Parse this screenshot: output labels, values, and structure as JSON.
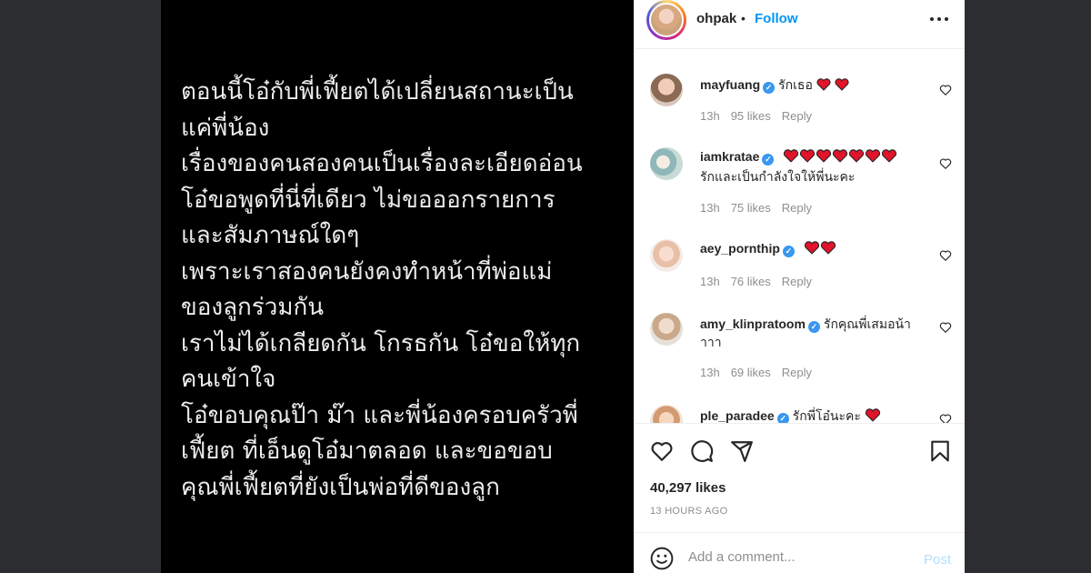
{
  "post": {
    "caption_lines": [
      "ตอนนี้โอ๋กับพี่เฟี้ยตได้เปลี่ยนสถานะเป็น",
      "แค่พี่น้อง",
      "เรื่องของคนสองคนเป็นเรื่องละเอียดอ่อน",
      "โอ๋ขอพูดที่นี่ที่เดียว ไม่ขอออกรายการ",
      "และสัมภาษณ์ใดๆ",
      "เพราะเราสองคนยังคงทำหน้าที่พ่อแม่",
      "ของลูกร่วมกัน",
      "เราไม่ได้เกลียดกัน โกรธกัน โอ๋ขอให้ทุก",
      "คนเข้าใจ",
      "โอ๋ขอบคุณป๊า ม๊า และพี่น้องครอบครัวพี่",
      "เฟี้ยต ที่เอ็นดูโอ๋มาตลอด และขอขอบ",
      "คุณพี่เฟี้ยตที่ยังเป็นพ่อที่ดีของลูก"
    ]
  },
  "header": {
    "username": "ohpak",
    "separator": "•",
    "follow_label": "Follow",
    "more_icon": "more-horizontal-icon"
  },
  "comments": [
    {
      "username": "mayfuang",
      "verified": true,
      "text": "รักเธอ",
      "hearts": 2,
      "text2": "",
      "time": "13h",
      "likes": "95 likes",
      "reply": "Reply"
    },
    {
      "username": "iamkratae",
      "verified": true,
      "text": "",
      "hearts": 7,
      "text2": "รักและเป็นกำลังใจให้พี่นะคะ",
      "time": "13h",
      "likes": "75 likes",
      "reply": "Reply"
    },
    {
      "username": "aey_pornthip",
      "verified": true,
      "text": "",
      "hearts": 2,
      "text2": "",
      "time": "13h",
      "likes": "76 likes",
      "reply": "Reply"
    },
    {
      "username": "amy_klinpratoom",
      "verified": true,
      "text": "รักคุณพี่เสมอน้า",
      "hearts": 0,
      "text2": "าาา",
      "time": "13h",
      "likes": "69 likes",
      "reply": "Reply"
    },
    {
      "username": "ple_paradee",
      "verified": true,
      "text": "รักพี่โอ๋นะคะ",
      "hearts": 1,
      "text2": "",
      "time": "",
      "likes": "",
      "reply": ""
    }
  ],
  "actions": {
    "likes": "40,297 likes",
    "timestamp": "13 HOURS AGO",
    "icons": [
      "heart-icon",
      "comment-icon",
      "share-icon",
      "bookmark-icon"
    ]
  },
  "comment_bar": {
    "placeholder": "Add a comment...",
    "post_label": "Post",
    "emoji_icon": "emoji-icon"
  },
  "colors": {
    "follow_blue": "#0095f6",
    "verified_blue": "#3897f0",
    "heart_red": "#e0142a",
    "post_disabled": "#b2dffc",
    "page_background": "#2b2d31"
  }
}
